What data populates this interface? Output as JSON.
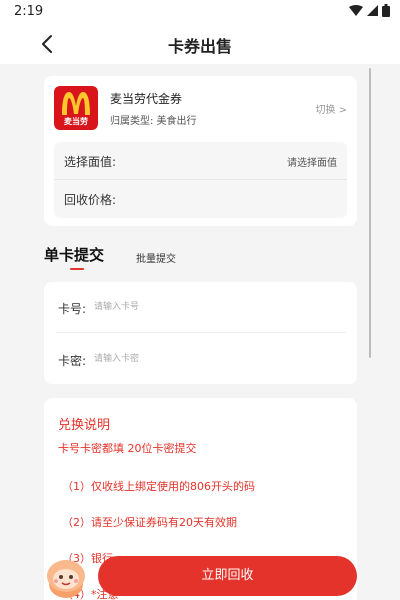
{
  "status_bar": {
    "time": "2:19",
    "icons": [
      "wifi-icon",
      "signal-icon",
      "battery-icon"
    ]
  },
  "nav": {
    "title": "卡券出售",
    "back_icon": "back-arrow-icon"
  },
  "product": {
    "logo_icon": "mcdonalds-logo",
    "logo_text": "麦当劳",
    "name": "麦当劳代金券",
    "type": "归属类型:  美食出行",
    "switch_label": "切换 >"
  },
  "fields": {
    "face_value_label": "选择面值:",
    "face_value_value": "请选择面值",
    "recycle_price_label": "回收价格:"
  },
  "tabs": {
    "single": "单卡提交",
    "batch": "批量提交",
    "active": "single"
  },
  "card_input": {
    "card_no_label": "卡号:",
    "card_no_placeholder": "请输入卡号",
    "card_pw_label": "卡密:",
    "card_pw_placeholder": "请输入卡密"
  },
  "instructions": {
    "title": "兑换说明",
    "subtitle": "卡号卡密都填 20位卡密提交",
    "items": [
      "（1）仅收线上绑定使用的806开头的码",
      "（2）请至少保证券码有20天有效期",
      "（3）银行",
      "（4）*注意*"
    ]
  },
  "submit": {
    "label": "立即回收"
  },
  "colors": {
    "accent": "#e4332a",
    "brand_red": "#d8151b",
    "brand_yellow": "#ffc72c"
  }
}
